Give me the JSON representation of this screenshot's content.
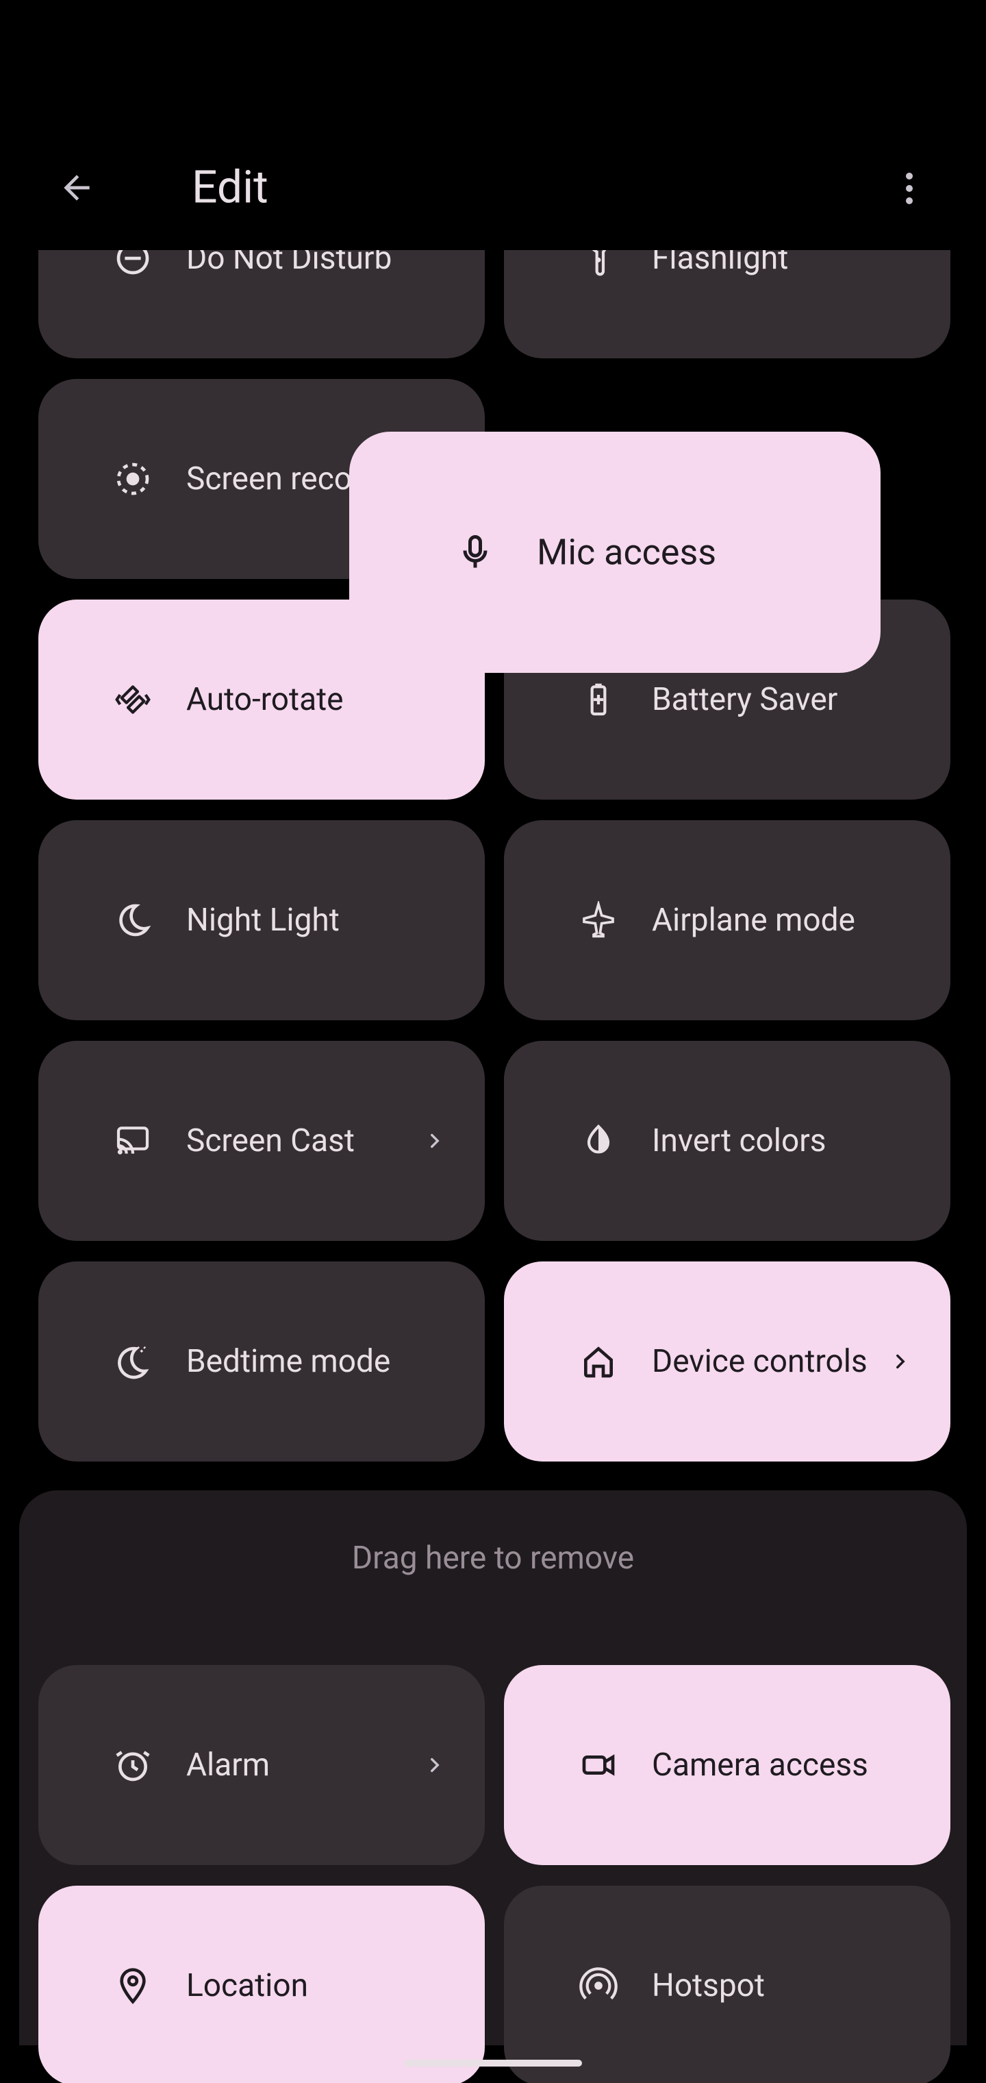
{
  "topbar": {
    "title": "Edit"
  },
  "tiles": {
    "dnd": {
      "label": "Do Not Disturb"
    },
    "flashlight": {
      "label": "Flashlight"
    },
    "screen_record": {
      "label": "Screen record"
    },
    "auto_rotate": {
      "label": "Auto-rotate"
    },
    "battery_saver": {
      "label": "Battery Saver"
    },
    "night_light": {
      "label": "Night Light"
    },
    "airplane": {
      "label": "Airplane mode"
    },
    "screen_cast": {
      "label": "Screen Cast"
    },
    "invert": {
      "label": "Invert colors"
    },
    "bedtime": {
      "label": "Bedtime mode"
    },
    "device_controls": {
      "label": "Device controls"
    },
    "alarm": {
      "label": "Alarm"
    },
    "camera_access": {
      "label": "Camera access"
    },
    "location": {
      "label": "Location"
    },
    "hotspot": {
      "label": "Hotspot"
    }
  },
  "dragging": {
    "label": "Mic access"
  },
  "tray": {
    "hint": "Drag here to remove"
  }
}
